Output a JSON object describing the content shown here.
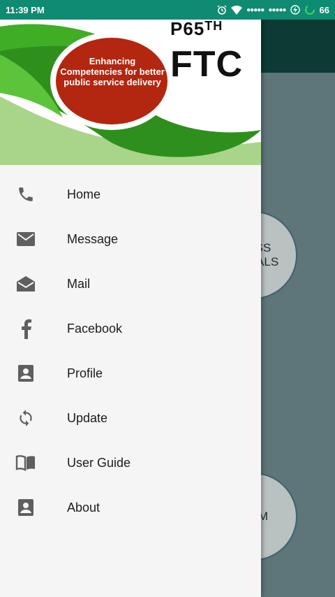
{
  "status_bar": {
    "time": "11:39 PM",
    "battery": "66",
    "icons": [
      "alarm-icon",
      "wifi-icon",
      "signal-icon",
      "signal-icon",
      "charging-icon",
      "battery-ring-icon"
    ]
  },
  "header": {
    "badge_text": "Enhancing Competencies for better public service delivery",
    "title_line1": "P65",
    "title_superscript": "TH",
    "title_line2": "FTC"
  },
  "background_page": {
    "button_1_text": "SS\nNALS",
    "button_2_text": "M"
  },
  "menu": {
    "items": [
      {
        "label": "Home",
        "icon": "phone-icon"
      },
      {
        "label": "Message",
        "icon": "envelope-icon"
      },
      {
        "label": "Mail",
        "icon": "open-mail-icon"
      },
      {
        "label": "Facebook",
        "icon": "facebook-icon"
      },
      {
        "label": "Profile",
        "icon": "contact-card-icon"
      },
      {
        "label": "Update",
        "icon": "sync-icon"
      },
      {
        "label": "User Guide",
        "icon": "book-icon"
      },
      {
        "label": "About",
        "icon": "contact-card-icon"
      }
    ]
  },
  "colors": {
    "status_bar": "#0f8a73",
    "toolbar": "#0b3b34",
    "drawer_bg": "#f5f5f5",
    "badge_red": "#b3260f",
    "leaf_green": "#2f8f1c",
    "icon_gray": "#5f5f5f"
  }
}
